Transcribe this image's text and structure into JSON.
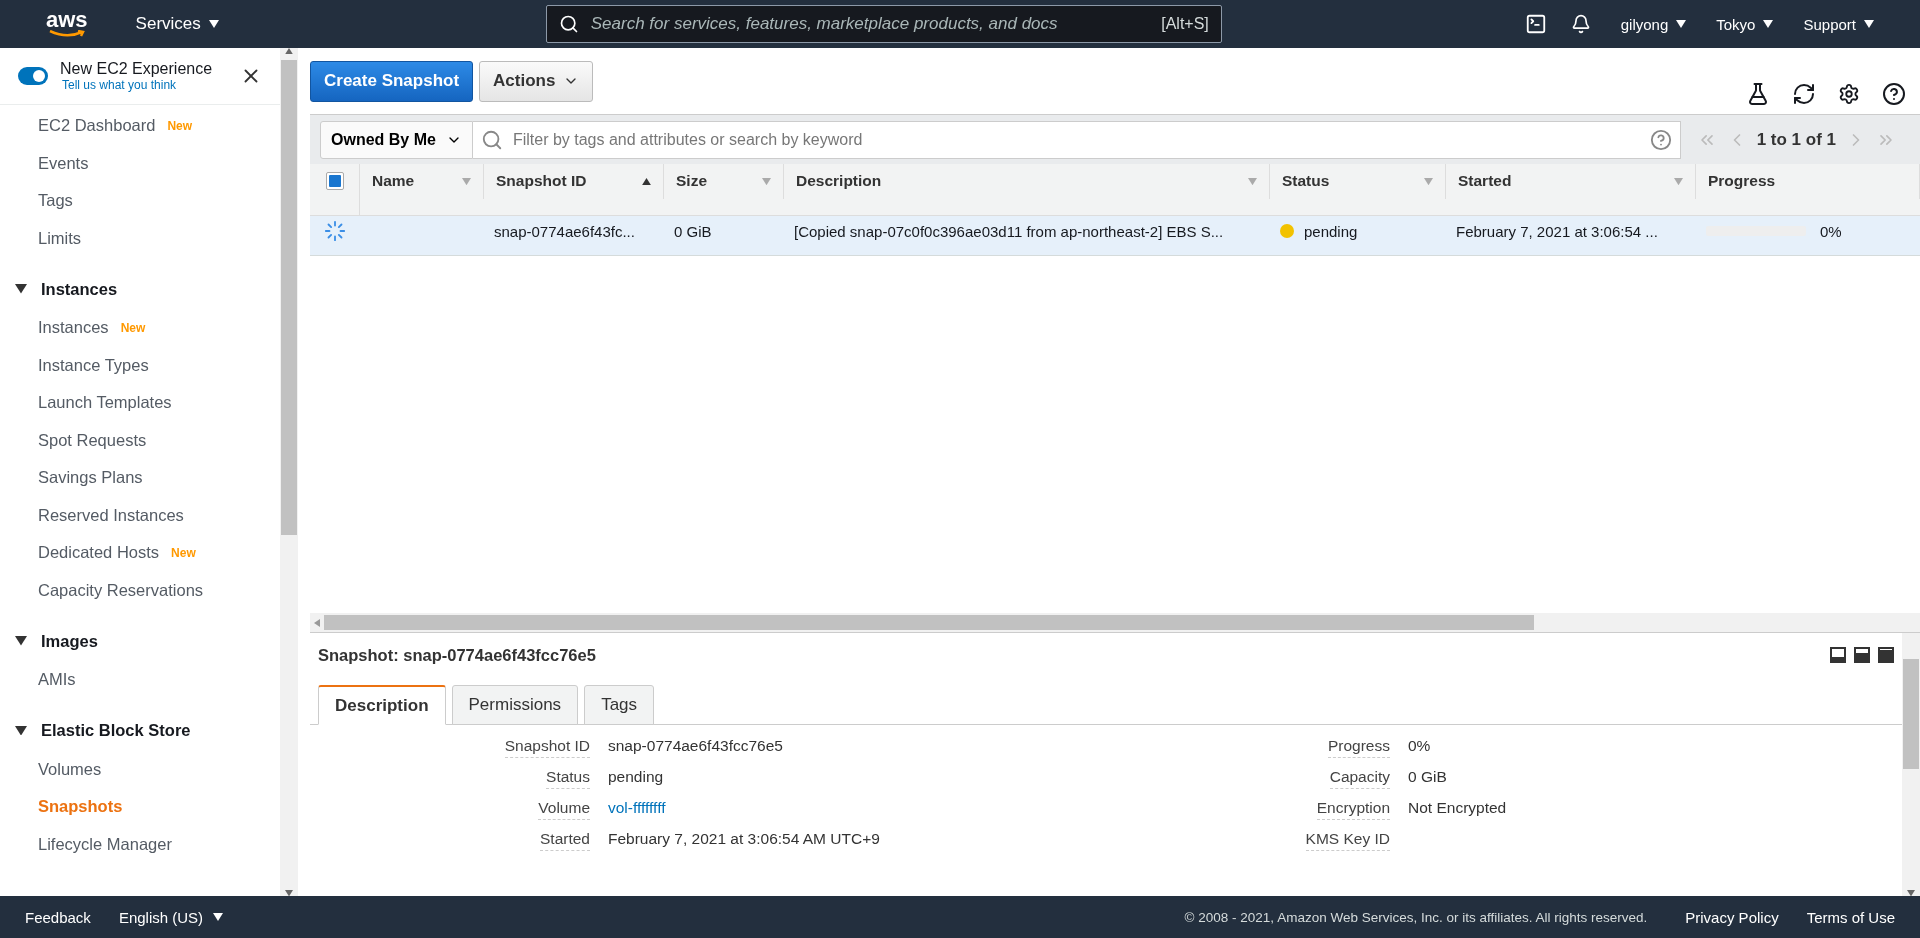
{
  "top_nav": {
    "logo": "aws",
    "services": "Services",
    "search": {
      "placeholder": "Search for services, features, marketplace products, and docs",
      "shortcut": "[Alt+S]"
    },
    "account": "gilyong",
    "region": "Tokyo",
    "support": "Support"
  },
  "sidebar": {
    "experience": {
      "label": "New EC2 Experience",
      "link": "Tell us what you think",
      "on": true
    },
    "items": [
      {
        "label": "EC2 Dashboard",
        "badge": "New",
        "selected": false
      },
      {
        "label": "Events",
        "selected": false
      },
      {
        "label": "Tags",
        "selected": false
      },
      {
        "label": "Limits",
        "selected": false
      }
    ],
    "sections": [
      {
        "title": "Instances",
        "expanded": true,
        "items": [
          {
            "label": "Instances",
            "badge": "New",
            "selected": false
          },
          {
            "label": "Instance Types",
            "selected": false
          },
          {
            "label": "Launch Templates",
            "selected": false
          },
          {
            "label": "Spot Requests",
            "selected": false
          },
          {
            "label": "Savings Plans",
            "selected": false
          },
          {
            "label": "Reserved Instances",
            "selected": false
          },
          {
            "label": "Dedicated Hosts",
            "badge": "New",
            "selected": false
          },
          {
            "label": "Capacity Reservations",
            "selected": false
          }
        ]
      },
      {
        "title": "Images",
        "expanded": true,
        "items": [
          {
            "label": "AMIs",
            "selected": false
          }
        ]
      },
      {
        "title": "Elastic Block Store",
        "expanded": true,
        "items": [
          {
            "label": "Volumes",
            "selected": false
          },
          {
            "label": "Snapshots",
            "selected": true
          },
          {
            "label": "Lifecycle Manager",
            "selected": false
          }
        ]
      }
    ]
  },
  "toolbar": {
    "create": "Create Snapshot",
    "actions": "Actions"
  },
  "filter": {
    "owner": "Owned By Me",
    "placeholder": "Filter by tags and attributes or search by keyword",
    "pagination": "1 to 1 of 1"
  },
  "table": {
    "checked": true,
    "columns": [
      {
        "label": "Name",
        "kind": "menu"
      },
      {
        "label": "Snapshot ID",
        "kind": "sorted"
      },
      {
        "label": "Size",
        "kind": "menu"
      },
      {
        "label": "Description",
        "kind": "menu"
      },
      {
        "label": "Status",
        "kind": "menu"
      },
      {
        "label": "Started",
        "kind": "menu"
      },
      {
        "label": "Progress",
        "kind": "plain"
      }
    ],
    "rows": [
      {
        "selected": true,
        "loading": true,
        "snapshot_id": "snap-0774ae6f43fc...",
        "size": "0 GiB",
        "description": "[Copied snap-07c0f0c396ae03d11 from ap-northeast-2] EBS S...",
        "status": {
          "text": "pending",
          "color": "#f2c200"
        },
        "started": "February 7, 2021 at 3:06:54 ...",
        "progress": {
          "level": 0,
          "reading": "0%"
        }
      }
    ]
  },
  "details": {
    "title": "Snapshot: snap-0774ae6f43fcc76e5",
    "tabs": [
      {
        "label": "Description",
        "selected": true
      },
      {
        "label": "Permissions",
        "selected": false
      },
      {
        "label": "Tags",
        "selected": false
      }
    ],
    "left": [
      {
        "label": "Snapshot ID",
        "value": "snap-0774ae6f43fcc76e5",
        "kind": "text"
      },
      {
        "label": "Status",
        "value": "pending",
        "kind": "text"
      },
      {
        "label": "Volume",
        "value": "vol-ffffffff",
        "kind": "link"
      },
      {
        "label": "Started",
        "value": "February 7, 2021 at 3:06:54 AM UTC+9",
        "kind": "text"
      }
    ],
    "right": [
      {
        "label": "Progress",
        "value": "0%",
        "kind": "text"
      },
      {
        "label": "Capacity",
        "value": "0 GiB",
        "kind": "text"
      },
      {
        "label": "Encryption",
        "value": "Not Encrypted",
        "kind": "text"
      },
      {
        "label": "KMS Key ID"
      }
    ]
  },
  "footer": {
    "feedback": "Feedback",
    "language": "English (US)",
    "copyright": "© 2008 - 2021, Amazon Web Services, Inc. or its affiliates. All rights reserved.",
    "links": [
      "Privacy Policy",
      "Terms of Use"
    ]
  }
}
